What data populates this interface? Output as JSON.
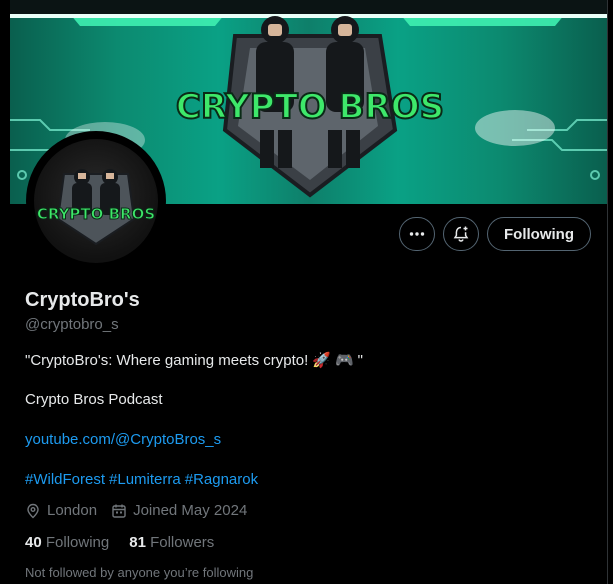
{
  "banner": {
    "logo_text_top": "CRYPTO BROS"
  },
  "avatar": {
    "logo_text": "CRYPTO BROS"
  },
  "actions": {
    "follow_label": "Following"
  },
  "profile": {
    "display_name": "CryptoBro's",
    "handle": "@cryptobro_s",
    "bio_text": "\"CryptoBro's: Where gaming meets crypto!",
    "bio_end": "\"",
    "bio_emoji_1": "🚀",
    "bio_emoji_2": "🎮",
    "line2": "Crypto Bros Podcast",
    "link": "youtube.com/@CryptoBros_s",
    "hashtags": [
      "#WildForest",
      "#Lumiterra",
      "#Ragnarok"
    ],
    "location": "London",
    "joined": "Joined May 2024",
    "following_count": "40",
    "following_label": "Following",
    "followers_count": "81",
    "followers_label": "Followers",
    "not_followed": "Not followed by anyone you’re following"
  },
  "icons": {
    "more": "more-dots-icon",
    "notify": "bell-plus-icon",
    "location": "location-pin-icon",
    "calendar": "calendar-icon"
  },
  "colors": {
    "link": "#1d9bf0",
    "muted": "#71767b",
    "text": "#e7e9ea",
    "banner_green": "#0aa185",
    "logo_green": "#3ee86a"
  }
}
